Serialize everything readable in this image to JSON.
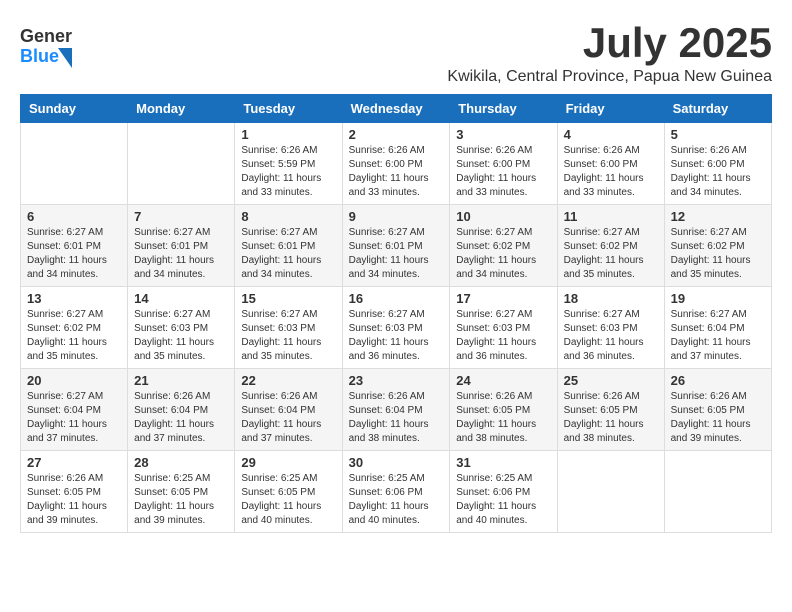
{
  "header": {
    "logo_line1": "General",
    "logo_line2": "Blue",
    "month": "July 2025",
    "location": "Kwikila, Central Province, Papua New Guinea"
  },
  "days_of_week": [
    "Sunday",
    "Monday",
    "Tuesday",
    "Wednesday",
    "Thursday",
    "Friday",
    "Saturday"
  ],
  "weeks": [
    [
      {
        "day": "",
        "info": ""
      },
      {
        "day": "",
        "info": ""
      },
      {
        "day": "1",
        "info": "Sunrise: 6:26 AM\nSunset: 5:59 PM\nDaylight: 11 hours and 33 minutes."
      },
      {
        "day": "2",
        "info": "Sunrise: 6:26 AM\nSunset: 6:00 PM\nDaylight: 11 hours and 33 minutes."
      },
      {
        "day": "3",
        "info": "Sunrise: 6:26 AM\nSunset: 6:00 PM\nDaylight: 11 hours and 33 minutes."
      },
      {
        "day": "4",
        "info": "Sunrise: 6:26 AM\nSunset: 6:00 PM\nDaylight: 11 hours and 33 minutes."
      },
      {
        "day": "5",
        "info": "Sunrise: 6:26 AM\nSunset: 6:00 PM\nDaylight: 11 hours and 34 minutes."
      }
    ],
    [
      {
        "day": "6",
        "info": "Sunrise: 6:27 AM\nSunset: 6:01 PM\nDaylight: 11 hours and 34 minutes."
      },
      {
        "day": "7",
        "info": "Sunrise: 6:27 AM\nSunset: 6:01 PM\nDaylight: 11 hours and 34 minutes."
      },
      {
        "day": "8",
        "info": "Sunrise: 6:27 AM\nSunset: 6:01 PM\nDaylight: 11 hours and 34 minutes."
      },
      {
        "day": "9",
        "info": "Sunrise: 6:27 AM\nSunset: 6:01 PM\nDaylight: 11 hours and 34 minutes."
      },
      {
        "day": "10",
        "info": "Sunrise: 6:27 AM\nSunset: 6:02 PM\nDaylight: 11 hours and 34 minutes."
      },
      {
        "day": "11",
        "info": "Sunrise: 6:27 AM\nSunset: 6:02 PM\nDaylight: 11 hours and 35 minutes."
      },
      {
        "day": "12",
        "info": "Sunrise: 6:27 AM\nSunset: 6:02 PM\nDaylight: 11 hours and 35 minutes."
      }
    ],
    [
      {
        "day": "13",
        "info": "Sunrise: 6:27 AM\nSunset: 6:02 PM\nDaylight: 11 hours and 35 minutes."
      },
      {
        "day": "14",
        "info": "Sunrise: 6:27 AM\nSunset: 6:03 PM\nDaylight: 11 hours and 35 minutes."
      },
      {
        "day": "15",
        "info": "Sunrise: 6:27 AM\nSunset: 6:03 PM\nDaylight: 11 hours and 35 minutes."
      },
      {
        "day": "16",
        "info": "Sunrise: 6:27 AM\nSunset: 6:03 PM\nDaylight: 11 hours and 36 minutes."
      },
      {
        "day": "17",
        "info": "Sunrise: 6:27 AM\nSunset: 6:03 PM\nDaylight: 11 hours and 36 minutes."
      },
      {
        "day": "18",
        "info": "Sunrise: 6:27 AM\nSunset: 6:03 PM\nDaylight: 11 hours and 36 minutes."
      },
      {
        "day": "19",
        "info": "Sunrise: 6:27 AM\nSunset: 6:04 PM\nDaylight: 11 hours and 37 minutes."
      }
    ],
    [
      {
        "day": "20",
        "info": "Sunrise: 6:27 AM\nSunset: 6:04 PM\nDaylight: 11 hours and 37 minutes."
      },
      {
        "day": "21",
        "info": "Sunrise: 6:26 AM\nSunset: 6:04 PM\nDaylight: 11 hours and 37 minutes."
      },
      {
        "day": "22",
        "info": "Sunrise: 6:26 AM\nSunset: 6:04 PM\nDaylight: 11 hours and 37 minutes."
      },
      {
        "day": "23",
        "info": "Sunrise: 6:26 AM\nSunset: 6:04 PM\nDaylight: 11 hours and 38 minutes."
      },
      {
        "day": "24",
        "info": "Sunrise: 6:26 AM\nSunset: 6:05 PM\nDaylight: 11 hours and 38 minutes."
      },
      {
        "day": "25",
        "info": "Sunrise: 6:26 AM\nSunset: 6:05 PM\nDaylight: 11 hours and 38 minutes."
      },
      {
        "day": "26",
        "info": "Sunrise: 6:26 AM\nSunset: 6:05 PM\nDaylight: 11 hours and 39 minutes."
      }
    ],
    [
      {
        "day": "27",
        "info": "Sunrise: 6:26 AM\nSunset: 6:05 PM\nDaylight: 11 hours and 39 minutes."
      },
      {
        "day": "28",
        "info": "Sunrise: 6:25 AM\nSunset: 6:05 PM\nDaylight: 11 hours and 39 minutes."
      },
      {
        "day": "29",
        "info": "Sunrise: 6:25 AM\nSunset: 6:05 PM\nDaylight: 11 hours and 40 minutes."
      },
      {
        "day": "30",
        "info": "Sunrise: 6:25 AM\nSunset: 6:06 PM\nDaylight: 11 hours and 40 minutes."
      },
      {
        "day": "31",
        "info": "Sunrise: 6:25 AM\nSunset: 6:06 PM\nDaylight: 11 hours and 40 minutes."
      },
      {
        "day": "",
        "info": ""
      },
      {
        "day": "",
        "info": ""
      }
    ]
  ]
}
